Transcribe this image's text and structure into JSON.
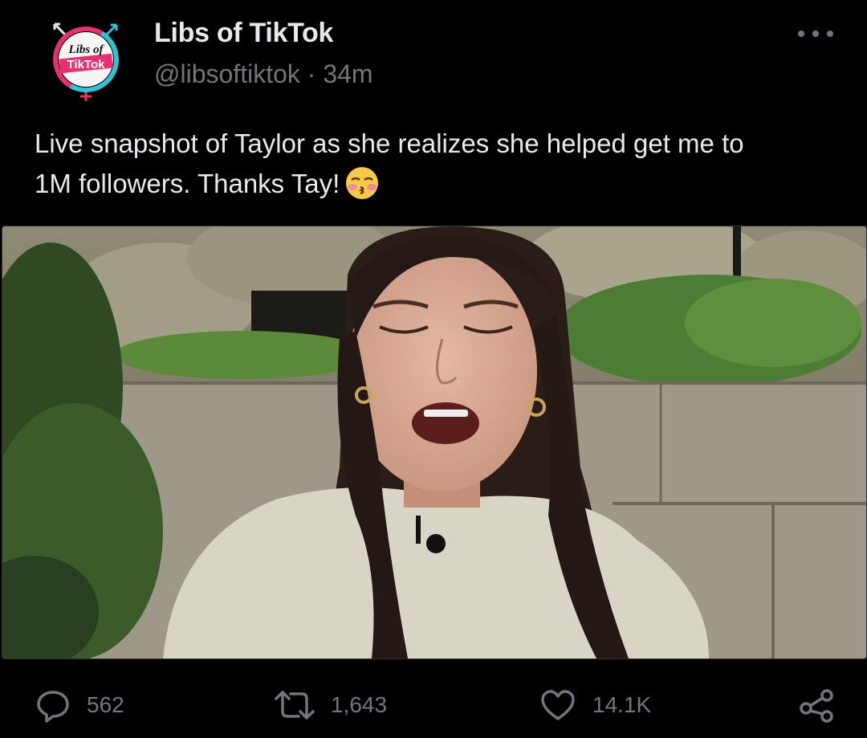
{
  "author": {
    "display_name": "Libs of TikTok",
    "handle": "@libsoftiktok",
    "time": "34m",
    "meta_line": "@libsoftiktok · 34m",
    "avatar_text_line1": "Libs of",
    "avatar_text_line2": "TikTok"
  },
  "tweet": {
    "text_line1": "Live snapshot of Taylor as she realizes she helped get me to",
    "text_line2": "1M followers. Thanks Tay!",
    "emoji": "kissing-face-with-closed-eyes"
  },
  "media": {
    "type": "photo"
  },
  "actions": {
    "replies": "562",
    "retweets": "1,643",
    "likes": "14.1K",
    "share_icon": "share-icon"
  },
  "colors": {
    "background": "#000000",
    "text_primary": "#e7e9ea",
    "text_secondary": "#71767b",
    "avatar_ring_pink": "#e8306e",
    "avatar_ring_cyan": "#2ec4d6"
  }
}
